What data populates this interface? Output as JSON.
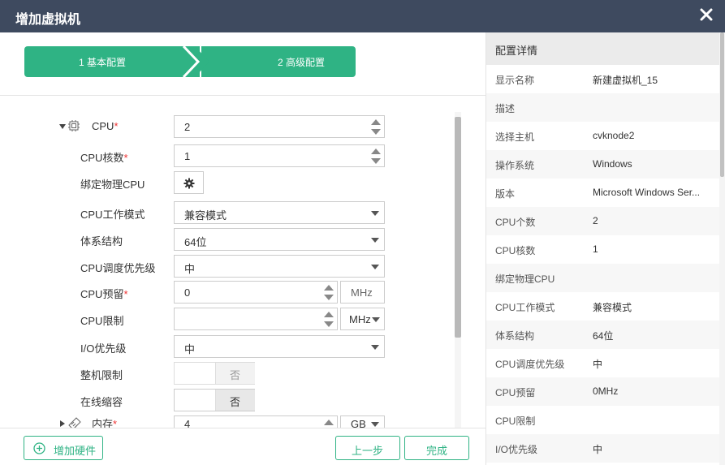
{
  "window": {
    "title": "增加虚拟机"
  },
  "steps": [
    {
      "label": "1 基本配置"
    },
    {
      "label": "2 高级配置"
    }
  ],
  "form": {
    "cpu": {
      "label": "CPU",
      "required": "*",
      "value": "2"
    },
    "cpu_cores": {
      "label": "CPU核数",
      "required": "*",
      "value": "1"
    },
    "bind_cpu": {
      "label": "绑定物理CPU"
    },
    "cpu_mode": {
      "label": "CPU工作模式",
      "value": "兼容模式"
    },
    "arch": {
      "label": "体系结构",
      "value": "64位"
    },
    "cpu_priority": {
      "label": "CPU调度优先级",
      "value": "中"
    },
    "cpu_reserve": {
      "label": "CPU预留",
      "required": "*",
      "value": "0",
      "unit": "MHz"
    },
    "cpu_limit": {
      "label": "CPU限制",
      "value": "",
      "unit": "MHz"
    },
    "io_priority": {
      "label": "I/O优先级",
      "value": "中"
    },
    "whole_limit": {
      "label": "整机限制",
      "value": "否"
    },
    "online_shrink": {
      "label": "在线缩容",
      "value": "否"
    },
    "memory": {
      "label": "内存",
      "required": "*",
      "value": "4",
      "unit": "GB"
    }
  },
  "footer": {
    "add_hardware": "增加硬件",
    "prev": "上一步",
    "finish": "完成"
  },
  "details": {
    "title": "配置详情",
    "rows": [
      {
        "k": "显示名称",
        "v": "新建虚拟机_15"
      },
      {
        "k": "描述",
        "v": ""
      },
      {
        "k": "选择主机",
        "v": "cvknode2"
      },
      {
        "k": "操作系统",
        "v": "Windows"
      },
      {
        "k": "版本",
        "v": "Microsoft Windows Ser..."
      },
      {
        "k": "CPU个数",
        "v": "2"
      },
      {
        "k": "CPU核数",
        "v": "1"
      },
      {
        "k": "绑定物理CPU",
        "v": ""
      },
      {
        "k": "CPU工作模式",
        "v": "兼容模式"
      },
      {
        "k": "体系结构",
        "v": "64位"
      },
      {
        "k": "CPU调度优先级",
        "v": "中"
      },
      {
        "k": "CPU预留",
        "v": "0MHz"
      },
      {
        "k": "CPU限制",
        "v": ""
      },
      {
        "k": "I/O优先级",
        "v": "中"
      }
    ]
  },
  "colors": {
    "accent": "#2fb384",
    "titlebar": "#3e4a5f"
  }
}
